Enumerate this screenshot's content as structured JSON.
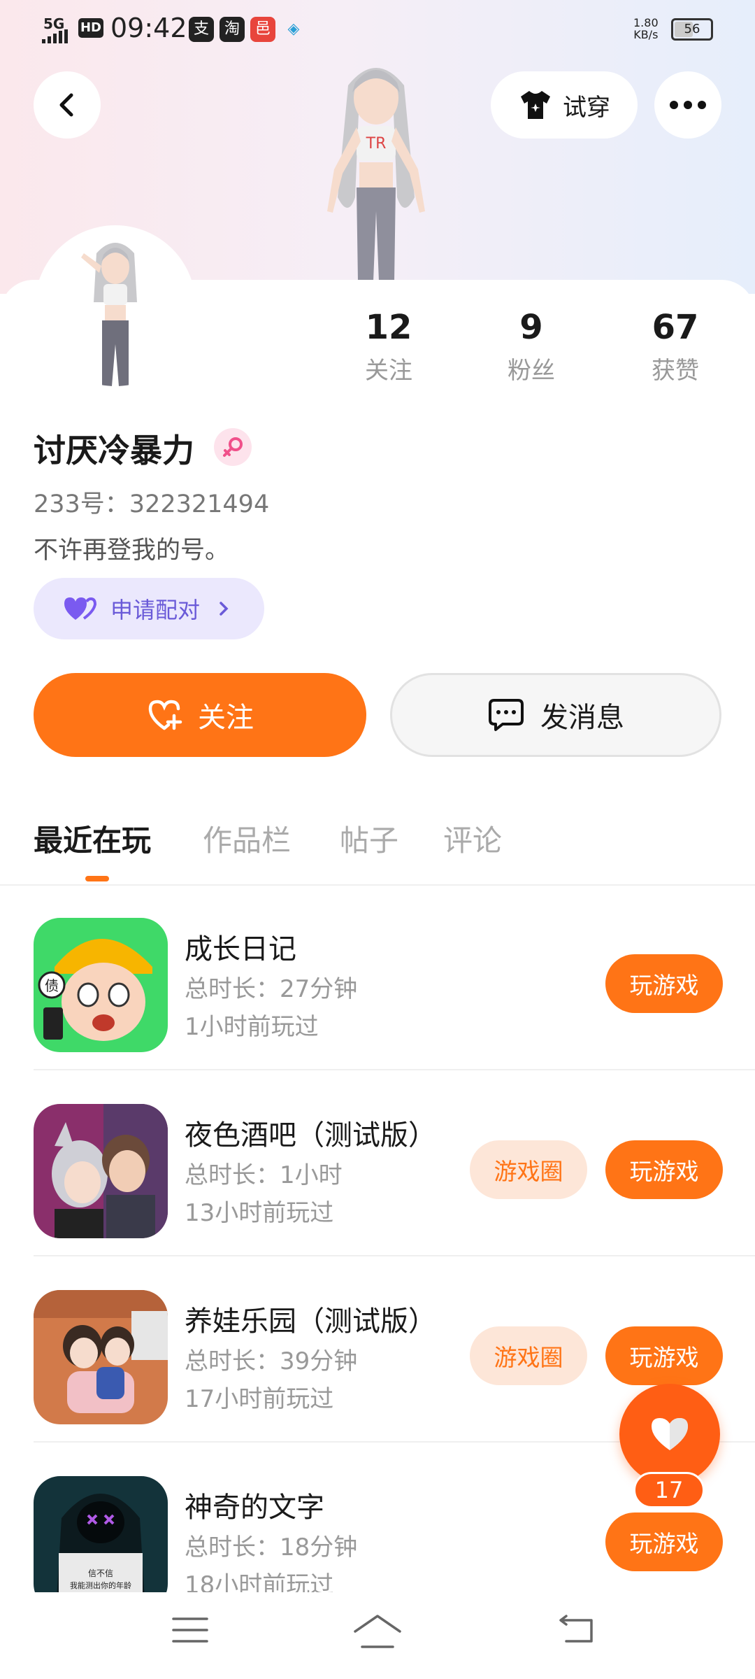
{
  "status_bar": {
    "network": "5G",
    "hd": "HD",
    "time": "09:42",
    "app_icons": [
      "支",
      "淘",
      "邑",
      "◈"
    ],
    "speed_value": "1.80",
    "speed_unit": "KB/s",
    "battery": "56"
  },
  "header": {
    "try_on_label": "试穿"
  },
  "profile": {
    "username": "讨厌冷暴力",
    "gender": "female",
    "uid": "233号：322321494",
    "bio": "不许再登我的号。",
    "pair_label": "申请配对",
    "stats": [
      {
        "value": "12",
        "label": "关注"
      },
      {
        "value": "9",
        "label": "粉丝"
      },
      {
        "value": "67",
        "label": "获赞"
      }
    ]
  },
  "actions": {
    "follow_label": "关注",
    "message_label": "发消息"
  },
  "tabs": [
    "最近在玩",
    "作品栏",
    "帖子",
    "评论"
  ],
  "active_tab": "最近在玩",
  "games": [
    {
      "title": "成长日记",
      "duration": "总时长：27分钟",
      "last_played": "1小时前玩过",
      "play_label": "玩游戏",
      "circle_label": null
    },
    {
      "title": "夜色酒吧（测试版）",
      "duration": "总时长：1小时",
      "last_played": "13小时前玩过",
      "play_label": "玩游戏",
      "circle_label": "游戏圈"
    },
    {
      "title": "养娃乐园（测试版）",
      "duration": "总时长：39分钟",
      "last_played": "17小时前玩过",
      "play_label": "玩游戏",
      "circle_label": "游戏圈"
    },
    {
      "title": "神奇的文字",
      "duration": "总时长：18分钟",
      "last_played": "18小时前玩过",
      "play_label": "玩游戏",
      "circle_label": null
    }
  ],
  "game4_icon_text": [
    "信不信",
    "我能测出你的年龄"
  ],
  "like_fab": {
    "count": "17"
  },
  "colors": {
    "accent": "#ff7416",
    "pair_bg": "#ebe8fd",
    "pair_text": "#6a5ad8",
    "circle_bg": "#fde6d8"
  }
}
